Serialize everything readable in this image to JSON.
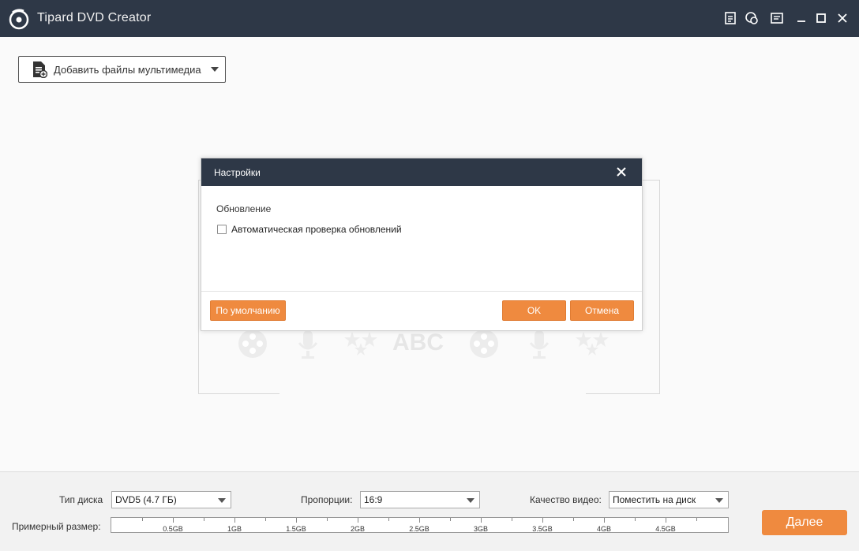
{
  "app": {
    "title": "Tipard DVD Creator"
  },
  "titlebar_icons": [
    "register-icon",
    "feedback-icon",
    "menu-icon",
    "minimize-icon",
    "maximize-icon",
    "close-icon"
  ],
  "toolbar": {
    "add_media_label": "Добавить файлы мультимедиа"
  },
  "dialog": {
    "title": "Настройки",
    "section_label": "Обновление",
    "checkbox_label": "Автоматическая проверка обновлений",
    "checkbox_checked": false,
    "default_button": "По умолчанию",
    "ok_button": "OK",
    "cancel_button": "Отмена"
  },
  "bottom": {
    "disc_type_label": "Тип диска",
    "disc_type_value": "DVD5 (4.7 ГБ)",
    "aspect_label": "Пропорции:",
    "aspect_value": "16:9",
    "quality_label": "Качество видео:",
    "quality_value": "Поместить на диск",
    "size_label": "Примерный размер:",
    "size_ticks": [
      "0.5GB",
      "1GB",
      "1.5GB",
      "2GB",
      "2.5GB",
      "3GB",
      "3.5GB",
      "4GB",
      "4.5GB"
    ],
    "next_button": "Далее"
  },
  "colors": {
    "titlebar": "#2e3847",
    "accent": "#ef8a3f"
  }
}
